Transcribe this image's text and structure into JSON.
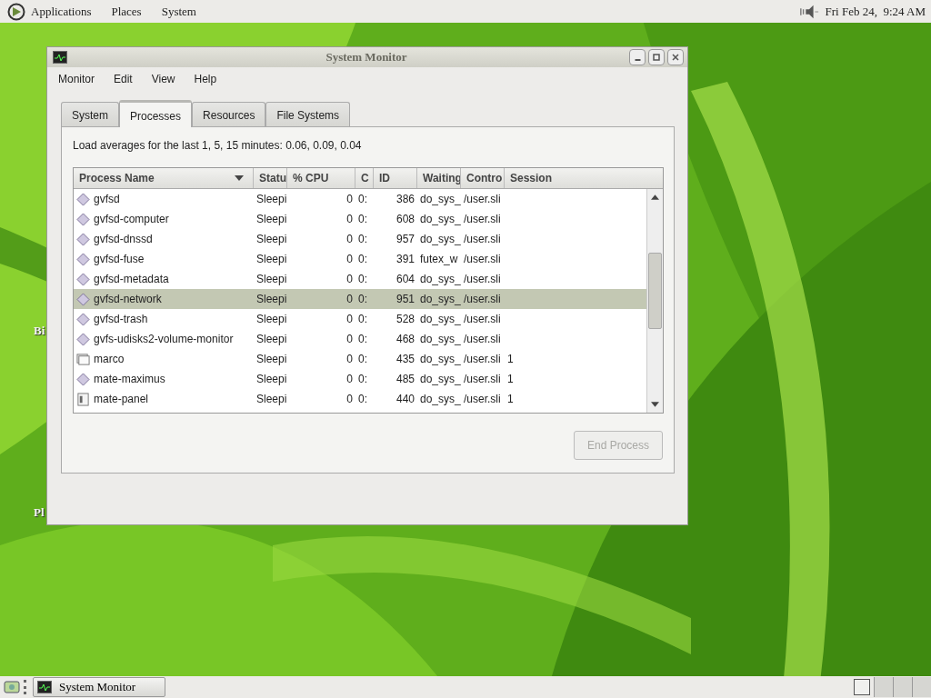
{
  "top_panel": {
    "menus": [
      "Applications",
      "Places",
      "System"
    ],
    "clock": "Fri Feb 24,  9:24 AM"
  },
  "desktop_icons": [
    {
      "label": "Bi"
    },
    {
      "label": "Pl"
    }
  ],
  "window": {
    "title": "System Monitor",
    "menu": [
      "Monitor",
      "Edit",
      "View",
      "Help"
    ],
    "tabs": [
      {
        "label": "System",
        "selected": false
      },
      {
        "label": "Processes",
        "selected": true
      },
      {
        "label": "Resources",
        "selected": false
      },
      {
        "label": "File Systems",
        "selected": false
      }
    ],
    "load_text": "Load averages for the last 1, 5, 15 minutes: 0.06, 0.09, 0.04",
    "table": {
      "columns": [
        "Process Name",
        "Statu",
        "% CPU",
        "C",
        "ID",
        "Waiting",
        "Contro",
        "Session"
      ],
      "rows": [
        {
          "kind": "diamond",
          "cells": [
            "gvfsd",
            "Sleepi",
            "0",
            "0:",
            "386",
            "do_sys_",
            "/user.sli"
          ],
          "selected": false
        },
        {
          "kind": "diamond",
          "cells": [
            "gvfsd-computer",
            "Sleepi",
            "0",
            "0:",
            "608",
            "do_sys_",
            "/user.sli"
          ],
          "selected": false
        },
        {
          "kind": "diamond",
          "cells": [
            "gvfsd-dnssd",
            "Sleepi",
            "0",
            "0:",
            "957",
            "do_sys_",
            "/user.sli"
          ],
          "selected": false
        },
        {
          "kind": "diamond",
          "cells": [
            "gvfsd-fuse",
            "Sleepi",
            "0",
            "0:",
            "391",
            "futex_w",
            "/user.sli"
          ],
          "selected": false
        },
        {
          "kind": "diamond",
          "cells": [
            "gvfsd-metadata",
            "Sleepi",
            "0",
            "0:",
            "604",
            "do_sys_",
            "/user.sli"
          ],
          "selected": false
        },
        {
          "kind": "diamond",
          "cells": [
            "gvfsd-network",
            "Sleepi",
            "0",
            "0:",
            "951",
            "do_sys_",
            "/user.sli"
          ],
          "selected": true
        },
        {
          "kind": "diamond",
          "cells": [
            "gvfsd-trash",
            "Sleepi",
            "0",
            "0:",
            "528",
            "do_sys_",
            "/user.sli"
          ],
          "selected": false
        },
        {
          "kind": "diamond",
          "cells": [
            "gvfs-udisks2-volume-monitor",
            "Sleepi",
            "0",
            "0:",
            "468",
            "do_sys_",
            "/user.sli"
          ],
          "selected": false
        },
        {
          "kind": "window",
          "cells": [
            "marco",
            "Sleepi",
            "0",
            "0:",
            "435",
            "do_sys_",
            "/user.sli",
            "1"
          ],
          "selected": false
        },
        {
          "kind": "diamond",
          "cells": [
            "mate-maximus",
            "Sleepi",
            "0",
            "0:",
            "485",
            "do_sys_",
            "/user.sli",
            "1"
          ],
          "selected": false
        },
        {
          "kind": "panel",
          "cells": [
            "mate-panel",
            "Sleepi",
            "0",
            "0:",
            "440",
            "do_sys_",
            "/user.sli",
            "1"
          ],
          "selected": false
        }
      ]
    },
    "end_button": {
      "label": "End Process",
      "disabled": true
    }
  },
  "taskbar": {
    "tasks": [
      {
        "label": "System Monitor"
      }
    ]
  }
}
